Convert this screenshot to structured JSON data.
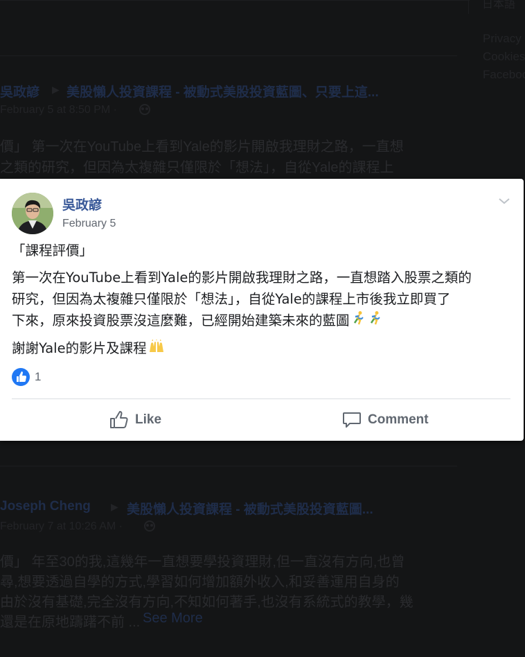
{
  "background": {
    "top_right_fragment": "日本語",
    "footer_links": [
      "Privacy",
      "Cookies",
      "Facebook"
    ],
    "post1": {
      "author": "吳政諺",
      "group": "美股懶人投資課程 - 被動式美股投資藍圖、只要上這...",
      "meta": "February 5 at 8:50 PM ·",
      "lines": [
        "價」 第一次在YouTube上看到Yale的影片開啟我理財之路，一直想",
        "之類的研究，但因為太複雜只僅限於「想法」，自從Yale的課程上"
      ]
    },
    "post2": {
      "author": "Joseph Cheng",
      "group": "美股懶人投資課程 - 被動式美股投資藍圖...",
      "meta": "February 7 at 10:26 AM ·",
      "lines": [
        "價」 年至30的我,這幾年一直想要學投資理財,但一直沒有方向,也曾",
        "尋,想要透過自學的方式,學習如何增加額外收入,和妥善運用自身的",
        "由於沒有基礎,完全沒有方向,不知如何著手,也沒有系統式的教學，幾",
        "還是在原地躊躇不前 ..."
      ],
      "see_more": "See More"
    }
  },
  "post": {
    "author": "吳政諺",
    "date": "February 5",
    "title_line": "「課程評價」",
    "body": "第一次在YouTube上看到Yale的影片開啟我理財之路，一直想踏入股票之類的",
    "body2": "研究，但因為太複雜只僅限於「想法」，自從Yale的課程上市後我立即買了",
    "body3": "下來，原來投資股票沒這麼難，已經開始建築未來的藍圖",
    "thanks": "謝謝Yale的影片及課程",
    "like_count": "1",
    "like_label": "Like",
    "comment_label": "Comment"
  },
  "colors": {
    "link_blue": "#385898",
    "like_blue": "#2078f4",
    "muted": "#606770"
  },
  "icons": [
    "chevron-down-icon",
    "like-reaction-icon",
    "thumbs-up-icon",
    "comment-icon",
    "runner-emoji",
    "raised-hands-emoji",
    "globe-icon"
  ]
}
